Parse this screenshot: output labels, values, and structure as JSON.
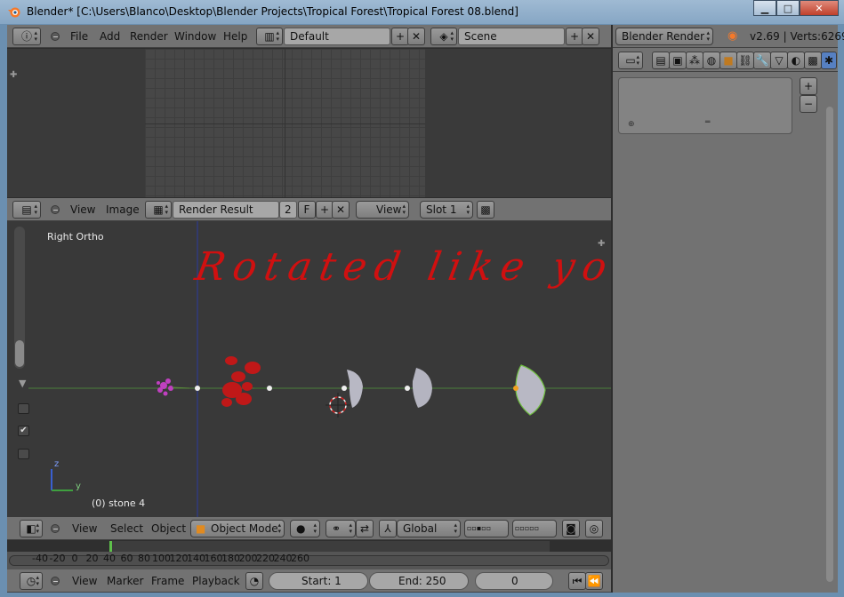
{
  "window": {
    "title": "Blender* [C:\\Users\\Blanco\\Desktop\\Blender Projects\\Tropical Forest\\Tropical Forest 08.blend]",
    "minimize": "▁",
    "maximize": "□",
    "close": "✕"
  },
  "info_header": {
    "menu": [
      "File",
      "Add",
      "Render",
      "Window",
      "Help"
    ],
    "layout": "Default",
    "scene": "Scene",
    "engine": "Blender Render",
    "version": "v2.69 | Verts:6269"
  },
  "image_editor_header": {
    "menu": [
      "View",
      "Image"
    ],
    "image_name": "Render Result",
    "users": "2",
    "fake": "F",
    "view": "View",
    "slot": "Slot 1"
  },
  "viewport": {
    "view_name": "Right Ortho",
    "object_info": "(0) stone 4",
    "annotation": "Rotated like you do.",
    "axis_z": "z",
    "axis_y": "y",
    "colors": {
      "grid_bg": "#393939",
      "y_axis_line": "#3f7f3f",
      "z_axis_line": "#2f3fa0",
      "annotation_red": "#d01010",
      "rose_red": "#c81818",
      "flower_magenta": "#c040c0",
      "stone_gray": "#b8b8c2"
    }
  },
  "viewport_header": {
    "menu": [
      "View",
      "Select",
      "Object"
    ],
    "mode": "Object Mode",
    "orientation": "Global"
  },
  "timeline": {
    "ticks": [
      "-40",
      "-20",
      "0",
      "20",
      "40",
      "60",
      "80",
      "100",
      "120",
      "140",
      "160",
      "180",
      "200",
      "220",
      "240",
      "260"
    ],
    "current_frame_label": "0",
    "current_frame": 0
  },
  "timeline_header": {
    "menu": [
      "View",
      "Marker",
      "Frame",
      "Playback"
    ],
    "start": "Start: 1",
    "end": "End: 250",
    "frame": "0"
  },
  "properties": {
    "add": "+",
    "remove": "−"
  }
}
